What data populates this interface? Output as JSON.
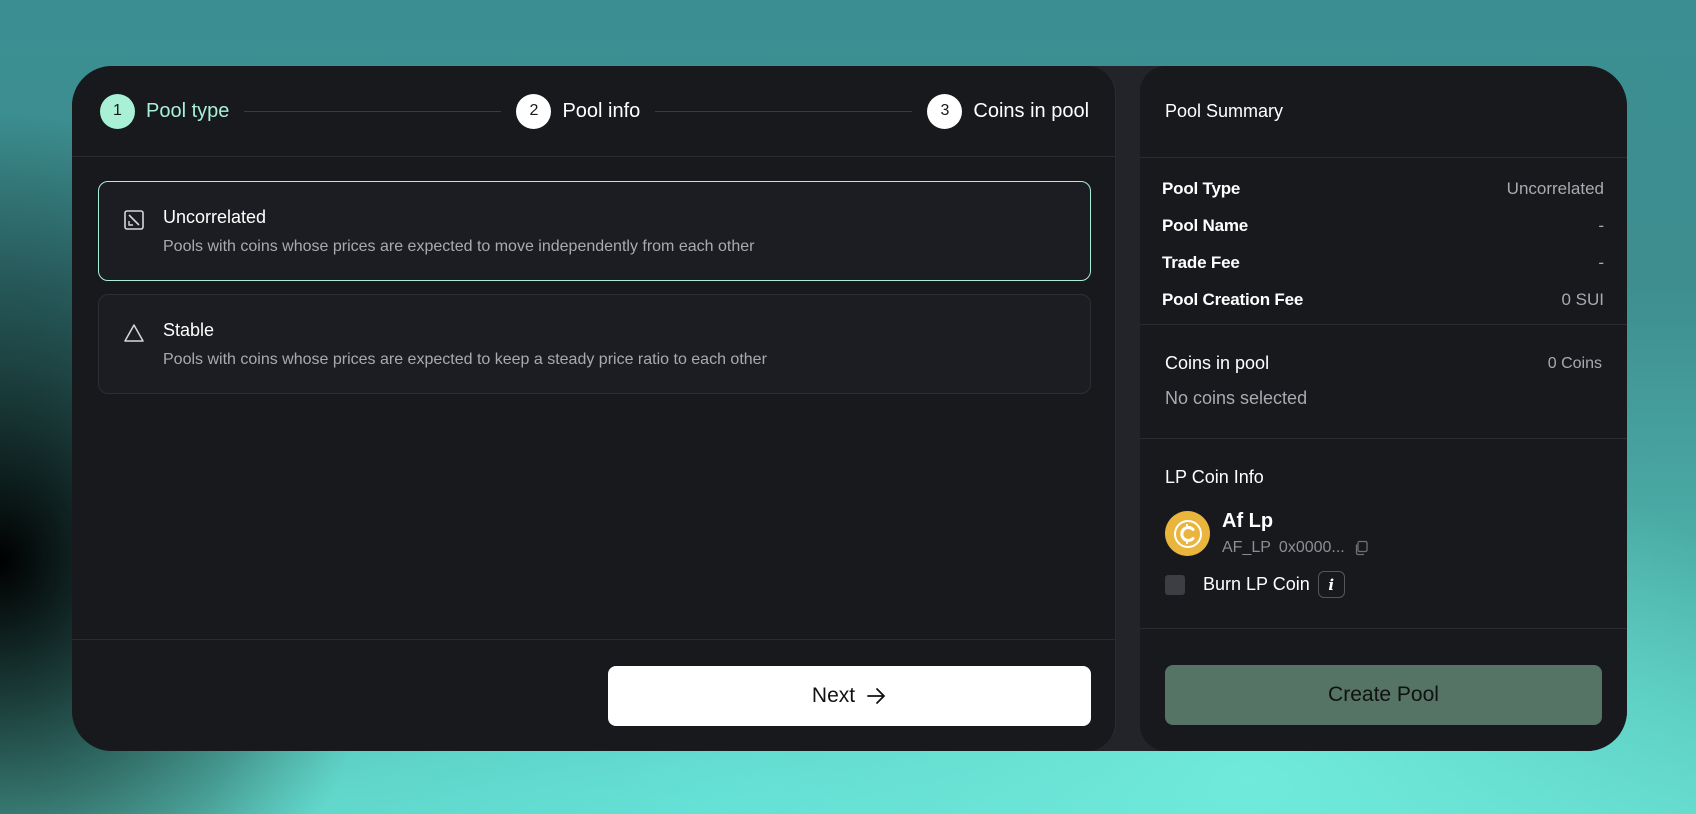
{
  "stepper": {
    "steps": [
      {
        "num": "1",
        "label": "Pool type"
      },
      {
        "num": "2",
        "label": "Pool info"
      },
      {
        "num": "3",
        "label": "Coins in pool"
      }
    ]
  },
  "pool_types": [
    {
      "title": "Uncorrelated",
      "desc": "Pools with coins whose prices are expected to move independently from each other",
      "icon": "uncorrelated-square-icon",
      "selected": true
    },
    {
      "title": "Stable",
      "desc": "Pools with coins whose prices are expected to keep a steady price ratio to each other",
      "icon": "triangle-icon",
      "selected": false
    }
  ],
  "next_button": {
    "label": "Next",
    "icon": "arrow-right-icon"
  },
  "summary": {
    "title": "Pool Summary",
    "rows": [
      {
        "key": "Pool Type",
        "value": "Uncorrelated"
      },
      {
        "key": "Pool Name",
        "value": "-"
      },
      {
        "key": "Trade Fee",
        "value": "-"
      },
      {
        "key": "Pool Creation Fee",
        "value": "0 SUI"
      }
    ],
    "coins": {
      "title": "Coins in pool",
      "count": "0 Coins",
      "empty": "No coins selected"
    },
    "lp": {
      "title": "LP Coin Info",
      "name": "Af Lp",
      "symbol": "AF_LP",
      "address": "0x0000...",
      "burn_label": "Burn LP Coin",
      "info_glyph": "i",
      "burn_checked": false
    },
    "create_button": "Create Pool"
  },
  "colors": {
    "accent": "#a8f0d6",
    "panel": "#18191d",
    "muted_text": "#a9aab0",
    "create_button": "#557466",
    "lp_coin": "#e9b53d"
  }
}
